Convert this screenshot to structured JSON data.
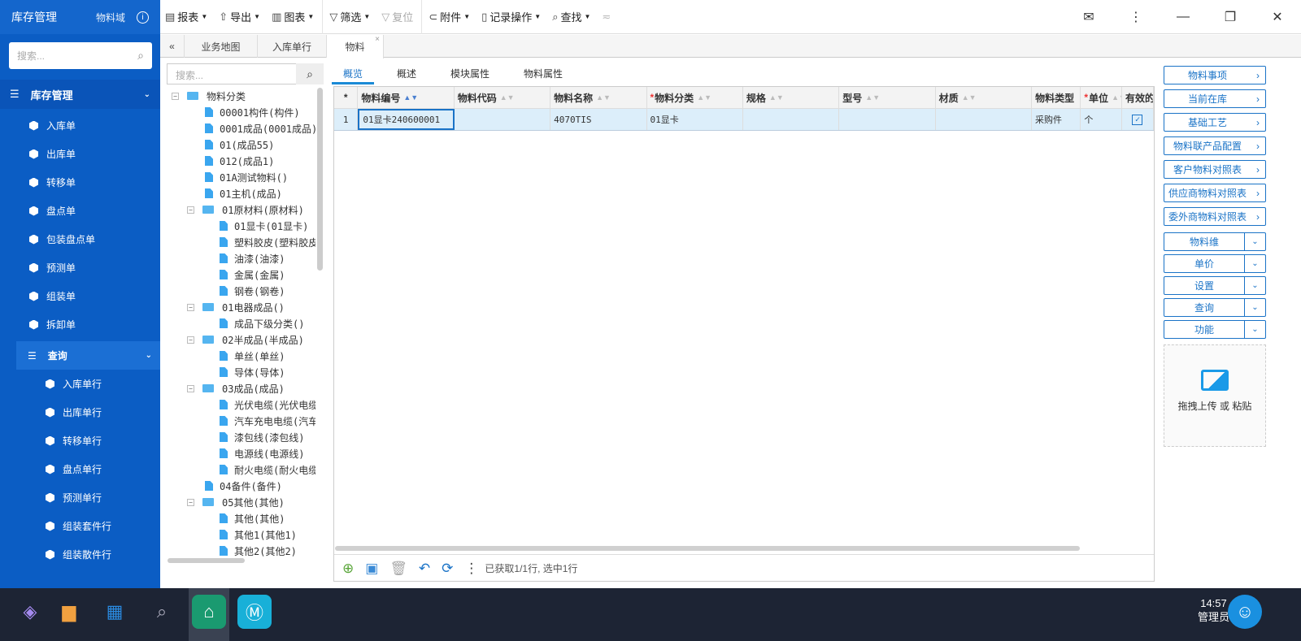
{
  "sidebar": {
    "title": "库存管理",
    "domain": "物料域",
    "search_placeholder": "搜索...",
    "section": "库存管理",
    "items": [
      "入库单",
      "出库单",
      "转移单",
      "盘点单",
      "包装盘点单",
      "预测单",
      "组装单",
      "拆卸单"
    ],
    "query": "查询",
    "query_items": [
      "入库单行",
      "出库单行",
      "转移单行",
      "盘点单行",
      "预测单行",
      "组装套件行",
      "组装散件行"
    ]
  },
  "toolbar": {
    "report": "报表",
    "export": "导出",
    "chart": "图表",
    "filter": "筛选",
    "reset": "复位",
    "attach": "附件",
    "record_ops": "记录操作",
    "find": "查找"
  },
  "tabs": [
    "业务地图",
    "入库单行",
    "物料"
  ],
  "tree": {
    "search_placeholder": "搜索...",
    "root": "物料分类",
    "nodes": [
      {
        "label": "00001构件(构件)",
        "level": 1,
        "type": "file"
      },
      {
        "label": "0001成品(0001成品)",
        "level": 1,
        "type": "file"
      },
      {
        "label": "01(成品55)",
        "level": 1,
        "type": "file"
      },
      {
        "label": "012(成品1)",
        "level": 1,
        "type": "file"
      },
      {
        "label": "01A测试物料()",
        "level": 1,
        "type": "file"
      },
      {
        "label": "01主机(成品)",
        "level": 1,
        "type": "file"
      },
      {
        "label": "01原材料(原材料)",
        "level": 1,
        "type": "folder"
      },
      {
        "label": "01显卡(01显卡)",
        "level": 2,
        "type": "file"
      },
      {
        "label": "塑料胶皮(塑料胶皮)",
        "level": 2,
        "type": "file"
      },
      {
        "label": "油漆(油漆)",
        "level": 2,
        "type": "file"
      },
      {
        "label": "金属(金属)",
        "level": 2,
        "type": "file"
      },
      {
        "label": "钢卷(钢卷)",
        "level": 2,
        "type": "file"
      },
      {
        "label": "01电器成品()",
        "level": 1,
        "type": "folder"
      },
      {
        "label": "成品下级分类()",
        "level": 2,
        "type": "file"
      },
      {
        "label": "02半成品(半成品)",
        "level": 1,
        "type": "folder"
      },
      {
        "label": "单丝(单丝)",
        "level": 2,
        "type": "file"
      },
      {
        "label": "导体(导体)",
        "level": 2,
        "type": "file"
      },
      {
        "label": "03成品(成品)",
        "level": 1,
        "type": "folder"
      },
      {
        "label": "光伏电缆(光伏电缆)",
        "level": 2,
        "type": "file"
      },
      {
        "label": "汽车充电电缆(汽车充电电缆)",
        "level": 2,
        "type": "file"
      },
      {
        "label": "漆包线(漆包线)",
        "level": 2,
        "type": "file"
      },
      {
        "label": "电源线(电源线)",
        "level": 2,
        "type": "file"
      },
      {
        "label": "耐火电缆(耐火电缆)",
        "level": 2,
        "type": "file"
      },
      {
        "label": "04备件(备件)",
        "level": 1,
        "type": "file"
      },
      {
        "label": "05其他(其他)",
        "level": 1,
        "type": "folder"
      },
      {
        "label": "其他(其他)",
        "level": 2,
        "type": "file"
      },
      {
        "label": "其他1(其他1)",
        "level": 2,
        "type": "file"
      },
      {
        "label": "其他2(其他2)",
        "level": 2,
        "type": "file"
      }
    ]
  },
  "subtabs": [
    "概览",
    "概述",
    "模块属性",
    "物料属性"
  ],
  "grid": {
    "star": "*",
    "columns": [
      "物料编号",
      "物料代码",
      "物料名称",
      "物料分类",
      "规格",
      "型号",
      "材质",
      "物料类型",
      "单位",
      "有效的"
    ],
    "rows": [
      {
        "num": "1",
        "cells": [
          "01显卡240600001",
          "",
          "4070TIS",
          "01显卡",
          "",
          "",
          "",
          "采购件",
          "个"
        ],
        "valid": true
      }
    ],
    "status": "已获取1/1行, 选中1行"
  },
  "right_panel": {
    "links": [
      "物料事项",
      "当前在库",
      "基础工艺",
      "物料联产品配置",
      "客户物料对照表",
      "供应商物料对照表",
      "委外商物料对照表"
    ],
    "dropdowns": [
      "物料维",
      "单价",
      "设置",
      "查询",
      "功能"
    ],
    "upload": "拖拽上传 或 粘贴"
  },
  "taskbar": {
    "time": "14:57",
    "user": "管理员"
  }
}
